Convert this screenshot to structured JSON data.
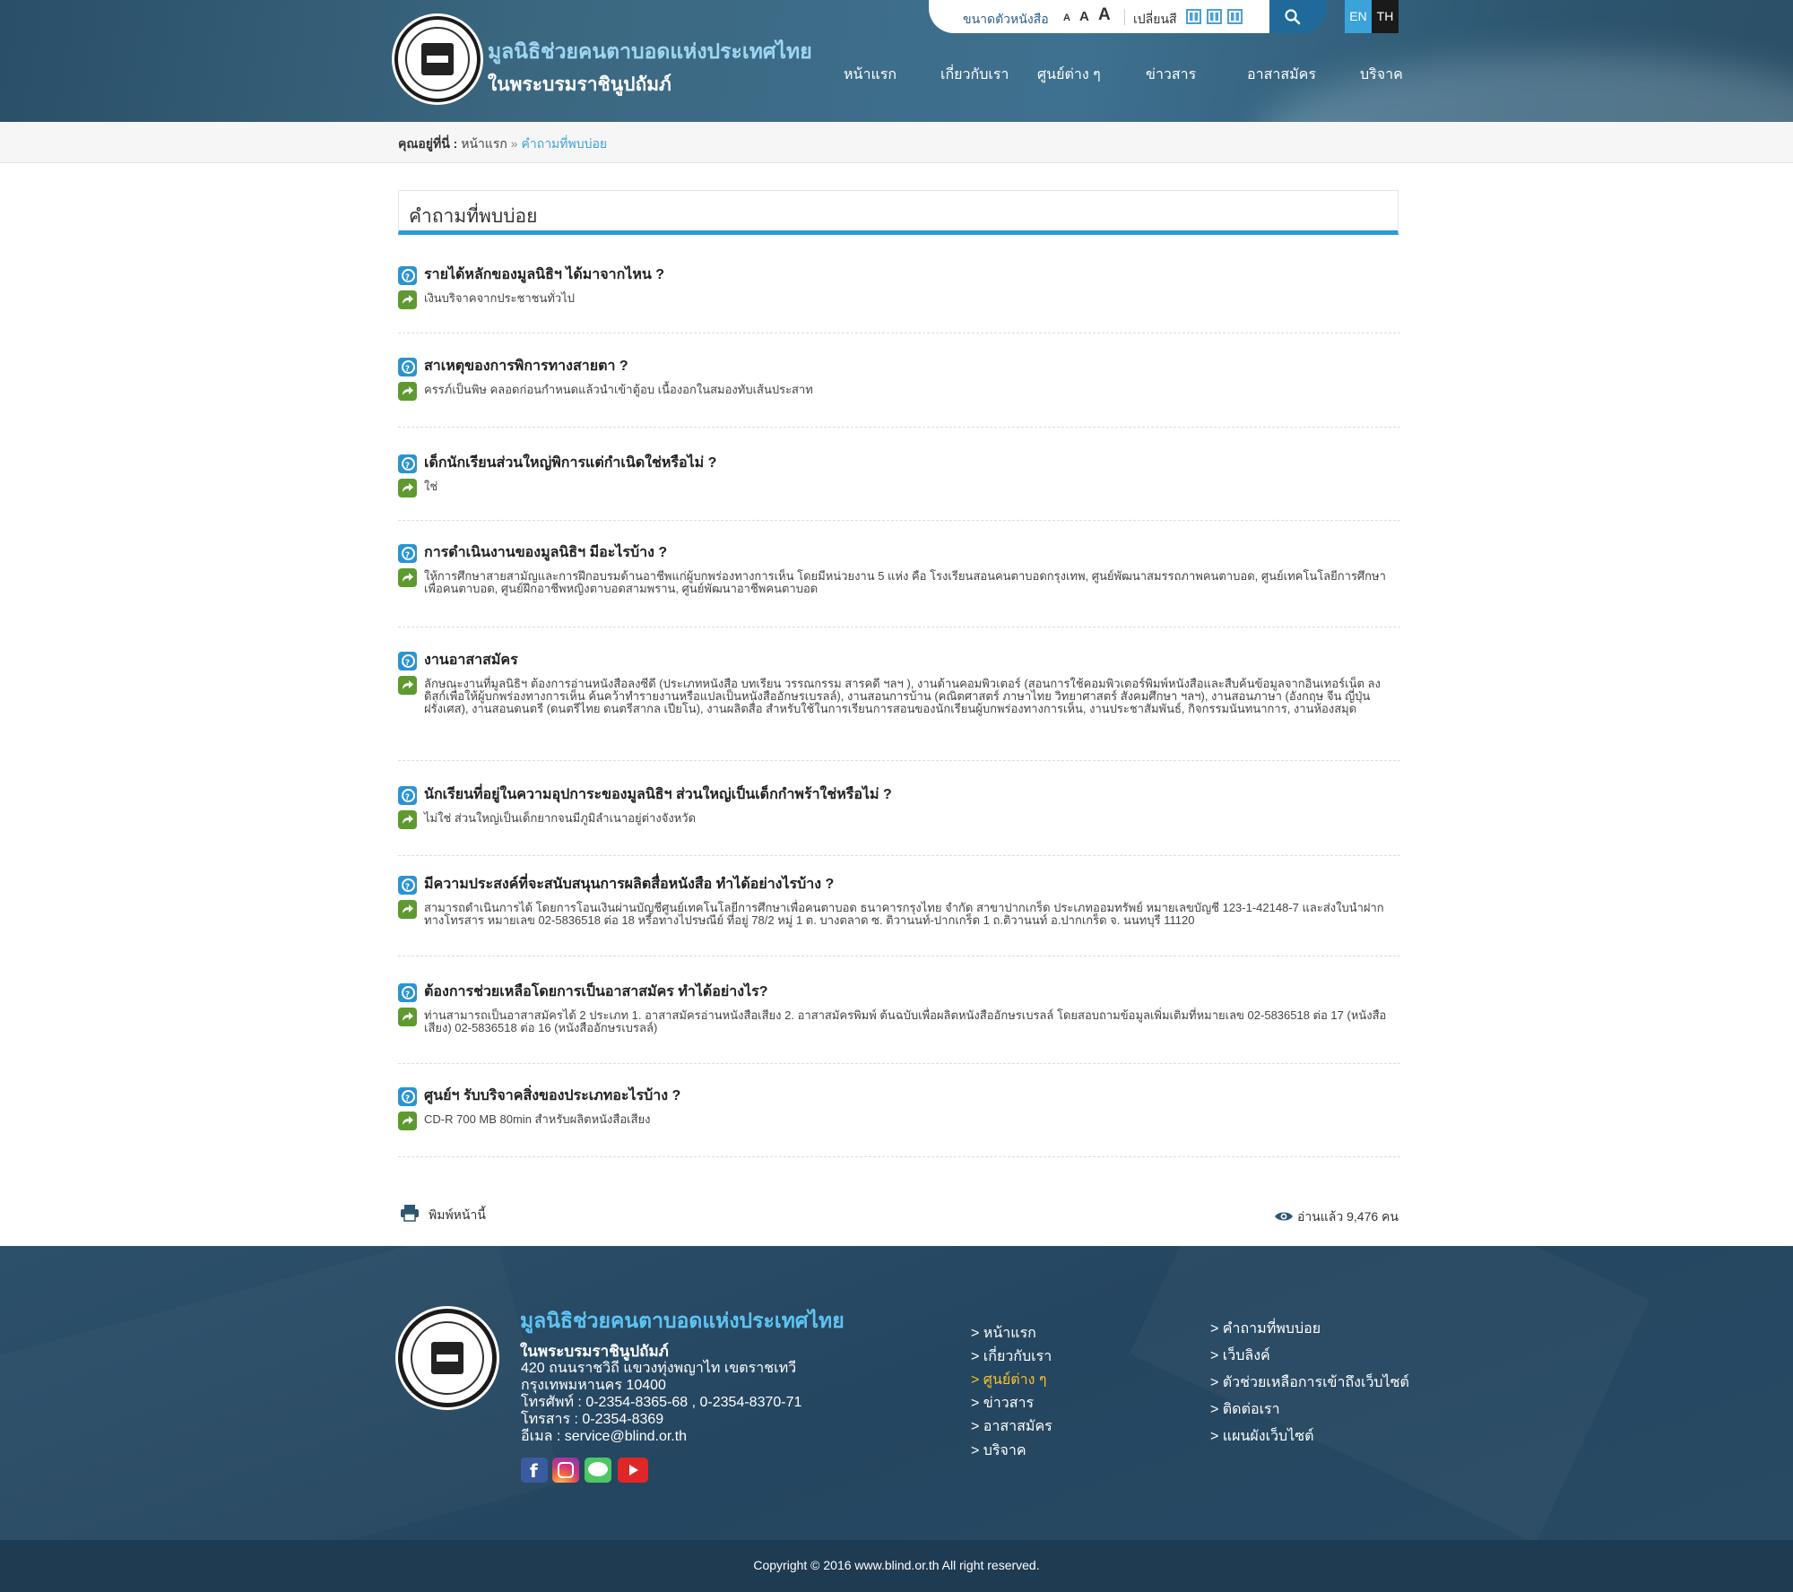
{
  "header": {
    "title_line1": "มูลนิธิช่วยคนตาบอดแห่งประเทศไทย",
    "title_line2": "ในพระบรมราชินูปถัมภ์",
    "font_size_label": "ขนาดตัวหนังสือ",
    "font_sizes": [
      "A",
      "A",
      "A"
    ],
    "color_label": "เปลี่ยนสี",
    "lang_en": "EN",
    "lang_th": "TH",
    "nav": [
      "หน้าแรก",
      "เกี่ยวกับเรา",
      "ศูนย์ต่าง ๆ",
      "ข่าวสาร",
      "อาสาสมัคร",
      "บริจาค"
    ]
  },
  "breadcrumb": {
    "label": "คุณอยู่ที่นี่ :",
    "home": "หน้าแรก",
    "sep": "»",
    "current": "คำถามที่พบบ่อย"
  },
  "page_title": "คำถามที่พบบ่อย",
  "faq": [
    {
      "q": "รายได้หลักของมูลนิธิฯ ได้มาจากไหน ?",
      "a": "เงินบริจาคจากประชาชนทั่วไป"
    },
    {
      "q": "สาเหตุของการพิการทางสายตา ?",
      "a": "ครรภ์เป็นพิษ  คลอดก่อนกำหนดแล้วนำเข้าตู้อบ  เนื้องอกในสมองทับเส้นประสาท"
    },
    {
      "q": "เด็กนักเรียนส่วนใหญ่พิการแต่กำเนิดใช่หรือไม่ ?",
      "a": "ใช่"
    },
    {
      "q": "การดำเนินงานของมูลนิธิฯ มีอะไรบ้าง ?",
      "a": "ให้การศึกษาสายสามัญและการฝึกอบรมด้านอาชีพแก่ผู้บกพร่องทางการเห็น โดยมีหน่วยงาน 5 แห่ง คือ โรงเรียนสอนคนตาบอดกรุงเทพ, ศูนย์พัฒนาสมรรถภาพคนตาบอด, ศูนย์เทคโนโลยีการศึกษาเพื่อคนตาบอด, ศูนย์ฝึกอาชีพหญิงตาบอดสามพราน, ศูนย์พัฒนาอาชีพคนตาบอด"
    },
    {
      "q": "งานอาสาสมัคร",
      "a": "ลักษณะงานที่มูลนิธิฯ ต้องการอ่านหนังสือลงซีดี (ประเภทหนังสือ  บทเรียน  วรรณกรรม  สารคดี ฯลฯ ), งานด้านคอมพิวเตอร์ (สอนการใช้คอมพิวเตอร์พิมพ์หนังสือและสืบค้นข้อมูลจากอินเทอร์เน็ต ลงดิสก์เพื่อให้ผู้บกพร่องทางการเห็น ค้นคว้าทำรายงานหรือแปลเป็นหนังสืออักษรเบรลล์), งานสอนการบ้าน (คณิตศาสตร์  ภาษาไทย วิทยาศาสตร์  สังคมศึกษา ฯลฯ), งานสอนภาษา  (อังกฤษ  จีน  ญี่ปุ่น ฝรั่งเศส), งานสอนดนตรี (ดนตรีไทย  ดนตรีสากล  เปียโน), งานผลิตสื่อ สำหรับใช้ในการเรียนการสอนของนักเรียนผู้บกพร่องทางการเห็น, งานประชาสัมพันธ์, กิจกรรมนันทนาการ, งานห้องสมุด"
    },
    {
      "q": "นักเรียนที่อยู่ในความอุปการะของมูลนิธิฯ ส่วนใหญ่เป็นเด็กกำพร้าใช่หรือไม่ ?",
      "a": "ไม่ใช่  ส่วนใหญ่เป็นเด็กยากจนมีภูมิลำเนาอยู่ต่างจังหวัด"
    },
    {
      "q": "มีความประสงค์ที่จะสนับสนุนการผลิตสื่อหนังสือ ทำได้อย่างไรบ้าง ?",
      "a": "สามารถดำเนินการได้    โดยการโอนเงินผ่านบัญชีศูนย์เทคโนโลยีการศึกษาเพื่อคนตาบอด ธนาคารกรุงไทย จำกัด สาขาปากเกร็ด ประเภทออมทรัพย์ หมายเลขบัญชี  123-1-42148-7 และส่งใบนำฝากทางโทรสาร หมายเลข 02-5836518 ต่อ 18 หรือทางไปรษณีย์ ที่อยู่ 78/2  หมู่ 1 ต. บางตลาด ซ. ติวานนท์-ปากเกร็ด 1 ถ.ติวานนท์ อ.ปากเกร็ด จ. นนทบุรี 11120"
    },
    {
      "q": "ต้องการช่วยเหลือโดยการเป็นอาสาสมัคร ทำได้อย่างไร?",
      "a": "ท่านสามารถเป็นอาสาสมัครได้ 2 ประเภท 1. อาสาสมัครอ่านหนังสือเสียง 2. อาสาสมัครพิมพ์ ต้นฉบับเพื่อผลิตหนังสืออักษรเบรลล์ โดยสอบถามข้อมูลเพิ่มเติมที่หมายเลข 02-5836518 ต่อ 17 (หนังสือเสียง)    02-5836518 ต่อ 16  (หนังสืออักษรเบรลล์)"
    },
    {
      "q": "ศูนย์ฯ รับบริจาคสิ่งของประเภทอะไรบ้าง ?",
      "a": "CD-R 700 MB 80min สำหรับผลิตหนังสือเสียง"
    }
  ],
  "actions": {
    "print": "พิมพ์หน้านี้",
    "views": "อ่านแล้ว 9,476 คน"
  },
  "footer": {
    "title_line1": "มูลนิธิช่วยคนตาบอดแห่งประเทศไทย",
    "title_line2": "ในพระบรมราชินูปถัมภ์",
    "address": [
      "420 ถนนราชวิถี แขวงทุ่งพญาไท เขตราชเทวี",
      "กรุงเทพมหานคร 10400",
      "โทรศัพท์ : 0-2354-8365-68 , 0-2354-8370-71",
      "โทรสาร : 0-2354-8369",
      "อีเมล : service@blind.or.th"
    ],
    "links_col1": [
      "> หน้าแรก",
      "> เกี่ยวกับเรา",
      "> ศูนย์ต่าง ๆ",
      "> ข่าวสาร",
      "> อาสาสมัคร",
      "> บริจาค"
    ],
    "links_col2": [
      "> คำถามที่พบบ่อย",
      "> เว็บลิงค์",
      "> ตัวช่วยเหลือการเข้าถึงเว็บไซต์",
      "> ติดต่อเรา",
      "> แผนผังเว็บไซต์"
    ],
    "copyright": "Copyright © 2016 www.blind.or.th All right reserved."
  },
  "colors": {
    "accent": "#2b9bd4",
    "answer_icon": "#5e9a2f",
    "footer_active": "#f7c22b"
  }
}
